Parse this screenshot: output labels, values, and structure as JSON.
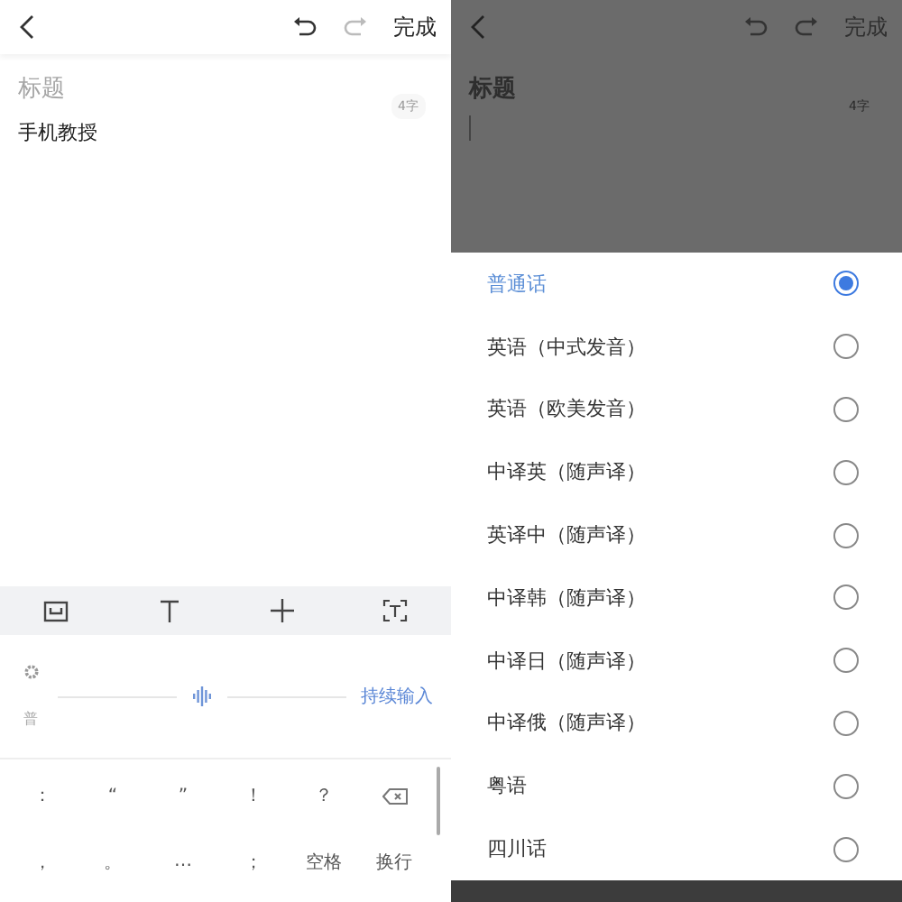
{
  "editor": {
    "done": "完成",
    "title_placeholder": "标题",
    "body": "手机教授",
    "word_count": "4字"
  },
  "voice": {
    "dialect": "普",
    "action": "持续输入"
  },
  "keys": [
    {
      "kind": "text",
      "label": "："
    },
    {
      "kind": "text",
      "label": "“"
    },
    {
      "kind": "text",
      "label": "”"
    },
    {
      "kind": "text",
      "label": "！"
    },
    {
      "kind": "text",
      "label": "？"
    },
    {
      "kind": "backspace"
    },
    {
      "kind": "text",
      "label": "，"
    },
    {
      "kind": "text",
      "label": "。"
    },
    {
      "kind": "text",
      "label": "…"
    },
    {
      "kind": "text",
      "label": "；"
    },
    {
      "kind": "text",
      "label": "空格"
    },
    {
      "kind": "text",
      "label": "换行"
    }
  ],
  "dimmed_editor": {
    "done": "完成",
    "title_placeholder": "标题",
    "word_count": "4字"
  },
  "languages": [
    {
      "label": "普通话",
      "selected": true
    },
    {
      "label": "英语（中式发音）",
      "selected": false
    },
    {
      "label": "英语（欧美发音）",
      "selected": false
    },
    {
      "label": "中译英（随声译）",
      "selected": false
    },
    {
      "label": "英译中（随声译）",
      "selected": false
    },
    {
      "label": "中译韩（随声译）",
      "selected": false
    },
    {
      "label": "中译日（随声译）",
      "selected": false
    },
    {
      "label": "中译俄（随声译）",
      "selected": false
    },
    {
      "label": "粤语",
      "selected": false
    },
    {
      "label": "四川话",
      "selected": false
    }
  ]
}
